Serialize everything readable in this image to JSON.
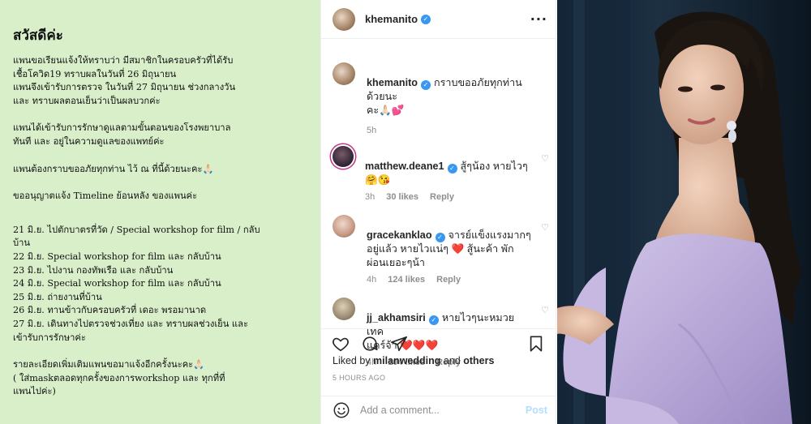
{
  "note": {
    "greeting": "สวัสดีค่ะ",
    "para1": "แพนขอเรียนแจ้งให้ทราบว่า มีสมาชิกในครอบครัวที่ได้รับ\nเชื้อโควิด19 ทราบผลในวันที่ 26 มิถุนายน\nแพนจึงเข้ารับการตรวจ ในวันที่ 27 มิถุนายน ช่วงกลางวัน\nและ ทราบผลตอนเย็นว่าเป็นผลบวกค่ะ",
    "para2": "แพนได้เข้ารับการรักษาดูแลตามขั้นตอนของโรงพยาบาล\nทันที และ อยู่ในความดูแลของแพทย์ค่ะ",
    "para3": "แพนต้องกราบขออภัยทุกท่าน ไว้ ณ ที่นี้ด้วยนะคะ🙏🏻",
    "para4": "ขออนุญาตแจ้ง Timeline ย้อนหลัง ของแพนค่ะ",
    "timeline": [
      "21 มิ.ย. ไปตักบาตรที่วัด / Special workshop for film / กลับ\nบ้าน",
      "22 มิ.ย. Special workshop for film  และ กลับบ้าน",
      "23 มิ.ย. ไปงาน กองทัพเรือ และ กลับบ้าน",
      "24 มิ.ย. Special workshop for film และ กลับบ้าน",
      "25 มิ.ย. ถ่ายงานที่บ้าน",
      "26 มิ.ย. ทานข้าวกับครอบครัวที่ เดอะ พรอมานาด",
      "27 มิ.ย. เดินทางไปตรวจช่วงเที่ยง และ ทราบผลช่วงเย็น และ\nเข้ารับการรักษาค่ะ"
    ],
    "para5": "รายละเอียดเพิ่มเติมแพนขอมาแจ้งอีกครั้งนะคะ🙏🏻\n( ใส่maskตลอดทุกครั้งของการworkshop และ ทุกที่ที่\nแพนไปค่ะ)"
  },
  "ig": {
    "header_user": "khemanito",
    "more_icon": "ellipsis-icon",
    "caption": {
      "user": "khemanito",
      "text": "กราบขออภัยทุกท่านด้วยนะ\nคะ🙏🏻💕",
      "time": "5h"
    },
    "comments": [
      {
        "user": "matthew.deane1",
        "text": "สู้ๆน้อง หายไวๆ\n🤗😘",
        "time": "3h",
        "likes": "30 likes",
        "reply": "Reply"
      },
      {
        "user": "gracekanklao",
        "text": "จารย์แข็งแรงมากๆ\nอยู่แล้ว หายไวแน่ๆ ❤️ สู้นะค้า พัก\nผ่อนเยอะๆน้า",
        "time": "4h",
        "likes": "124 likes",
        "reply": "Reply"
      },
      {
        "user": "jj_akhamsiri",
        "text": "หายไวๆนะหมวย เทค\nแคร์จ้า ❤️❤️❤️",
        "time": "4h",
        "likes": "104 likes",
        "reply": "Reply"
      }
    ],
    "liked_by_prefix": "Liked by",
    "liked_by_user": "milanwedding",
    "liked_by_and": "and",
    "liked_by_others": "others",
    "time_ago": "5 HOURS AGO",
    "add_comment_placeholder": "Add a comment...",
    "post_label": "Post",
    "accent": "#3897f0"
  },
  "photo": {
    "description_icon": "portrait-photo"
  }
}
